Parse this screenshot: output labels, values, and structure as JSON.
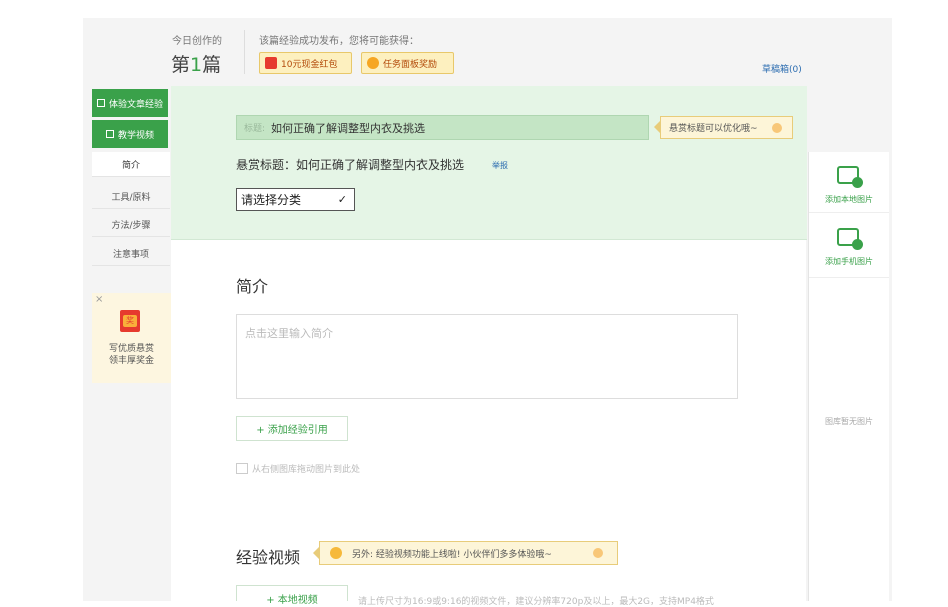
{
  "header": {
    "today_label": "今日创作的",
    "today_prefix": "第",
    "today_count": "1",
    "today_suffix": "篇",
    "reward_hint": "该篇经验成功发布，您将可能获得：",
    "badges": [
      {
        "label": "10元现金红包",
        "icon": "red-envelope-icon"
      },
      {
        "label": "任务面板奖励",
        "icon": "coin-icon"
      }
    ],
    "drafts_label": "草稿箱(0)"
  },
  "sidebar": {
    "top_buttons": [
      {
        "label": "体验文章经验"
      },
      {
        "label": "教学视频"
      }
    ],
    "items": [
      {
        "label": "简介",
        "active": true
      },
      {
        "label": "工具/原料",
        "active": false
      },
      {
        "label": "方法/步骤",
        "active": false
      },
      {
        "label": "注意事项",
        "active": false
      }
    ],
    "promo": {
      "close": "×",
      "envelope_text": "奖",
      "line1": "写优质悬赏",
      "line2": "领丰厚奖金"
    }
  },
  "editor": {
    "title_field_label": "标题:",
    "title_value": "如何正确了解调整型内衣及挑选",
    "title_tip": "悬赏标题可以优化哦~",
    "reward_title_label": "悬赏标题：如何正确了解调整型内衣及挑选",
    "report_link": "举报",
    "category_select": "请选择分类",
    "intro_heading": "简介",
    "intro_placeholder": "点击这里输入简介",
    "add_reference_button": "+ 添加经验引用",
    "drag_hint": "从右侧图库拖动图片到此处",
    "video_heading": "经验视频",
    "video_tip": "另外: 经验视频功能上线啦! 小伙伴们多多体验哦~",
    "local_video_button": "+ 本地视频",
    "upload_note": "请上传尺寸为16:9或9:16的视频文件，建议分辨率720p及以上，最大2G，支持MP4格式"
  },
  "right_panel": {
    "add_local_image": "添加本地图片",
    "add_phone_image": "添加手机图片",
    "empty_gallery": "图库暂无图片"
  },
  "colors": {
    "brand_green": "#3aa14a",
    "panel_green": "#e5f5e6",
    "tip_yellow": "#fdf5d8",
    "link_blue": "#2b6cb0"
  }
}
